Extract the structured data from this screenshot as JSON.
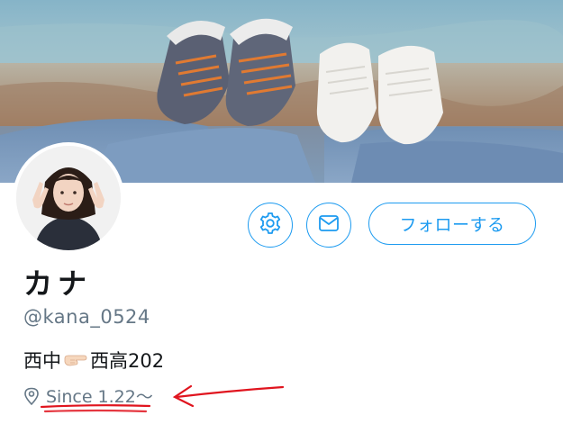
{
  "profile": {
    "display_name": "カナ",
    "handle": "@kana_0524",
    "bio_before": "西中",
    "bio_after": "西高202",
    "location": "Since 1.22〜"
  },
  "actions": {
    "follow_label": "フォローする"
  },
  "icons": {
    "settings": "gear-icon",
    "message": "envelope-icon",
    "bio_emoji": "pointing-finger-icon",
    "location": "location-pin-icon"
  },
  "colors": {
    "accent": "#1d9bf0",
    "secondary_text": "#657786",
    "primary_text": "#14171a",
    "annotation": "#e0141e"
  }
}
